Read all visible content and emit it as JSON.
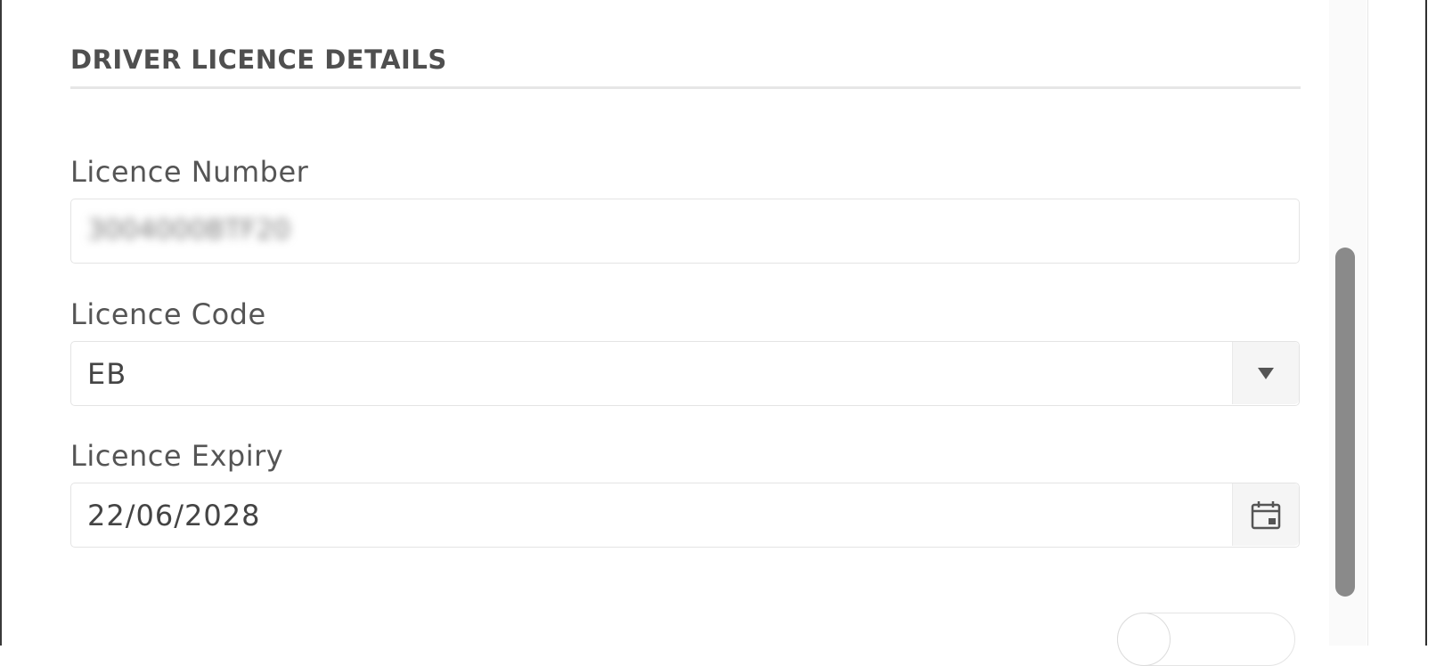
{
  "section": {
    "title": "DRIVER LICENCE DETAILS"
  },
  "fields": {
    "licence_number": {
      "label": "Licence Number",
      "value": "3004000BTF20"
    },
    "licence_code": {
      "label": "Licence Code",
      "value": "EB",
      "addon_icon": "chevron-down-icon"
    },
    "licence_expiry": {
      "label": "Licence Expiry",
      "value": "22/06/2028",
      "addon_icon": "calendar-icon"
    }
  },
  "colors": {
    "title_text": "#4f4f4f",
    "label_text": "#555555",
    "border": "#e4e4e4",
    "scroll_thumb": "#8a8a8a"
  }
}
